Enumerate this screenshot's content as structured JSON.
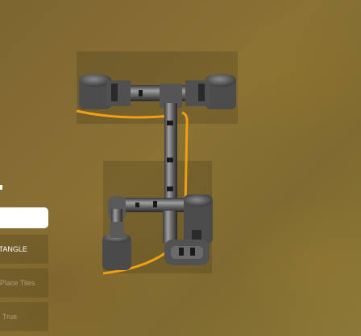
{
  "panel": {
    "mode_label": "CTANGLE",
    "tool_label": ": Place Tiles",
    "snap_label": "r: True"
  },
  "colors": {
    "ground": "#80692f",
    "pipe": "#5a5a5a",
    "pipe_highlight": "#9a9a9a",
    "flow_line": "#f0a010",
    "field_bg": "#ffffff"
  }
}
